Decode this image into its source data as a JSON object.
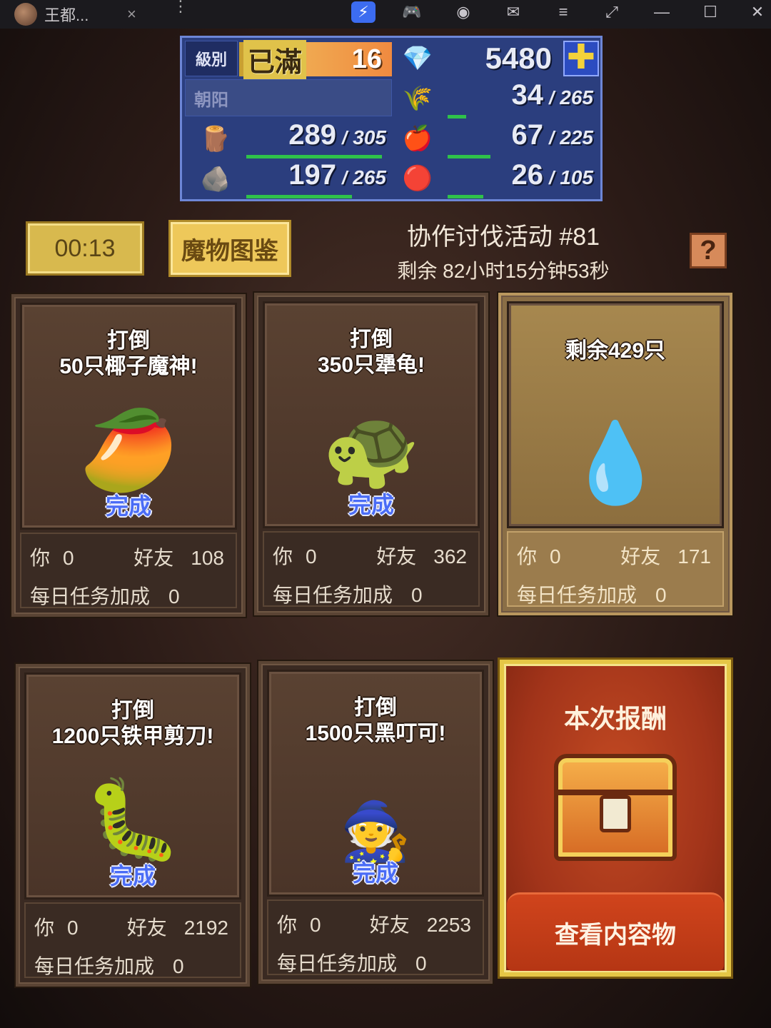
{
  "titlebar": {
    "tab_title": "王都...",
    "tab_close": "×",
    "more": "⋮",
    "icons": [
      "app-active-icon",
      "gamepad-icon",
      "account-icon",
      "mail-icon",
      "menu-icon",
      "screenshot-icon",
      "minimize-icon",
      "maximize-icon",
      "close-icon"
    ],
    "icon_glyphs": [
      "⚡",
      "🎮",
      "◉",
      "✉",
      "≡",
      "⤢",
      "—",
      "☐",
      "✕"
    ]
  },
  "status": {
    "level_label": "級別",
    "level_state": "已滿",
    "level_num": "16",
    "town_name": "朝阳",
    "gems": "5480",
    "plus": "✚",
    "resources_left": [
      {
        "icon": "🪵",
        "name": "wood-icon",
        "current": "289",
        "max": "305",
        "fill": 0.95
      },
      {
        "icon": "🪨",
        "name": "ore-icon",
        "current": "197",
        "max": "265",
        "fill": 0.74
      }
    ],
    "resources_right": [
      {
        "icon": "🌾",
        "name": "grass-icon",
        "current": "34",
        "max": "265",
        "fill": 0.13
      },
      {
        "icon": "🍎",
        "name": "food-icon",
        "current": "67",
        "max": "225",
        "fill": 0.3
      },
      {
        "icon": "🔴",
        "name": "crystal-icon",
        "current": "26",
        "max": "105",
        "fill": 0.25
      }
    ],
    "gem_icon": "💎"
  },
  "event": {
    "timer": "00:13",
    "bestiary_button": "魔物图鉴",
    "title": "协作讨伐活动 #81",
    "remaining": "剩余 82小时15分钟53秒",
    "help": "?"
  },
  "quests": [
    {
      "line1": "打倒",
      "line2": "50只椰子魔神!",
      "monster": "🥭",
      "done": "完成",
      "you_label": "你",
      "you": "0",
      "friend_label": "好友",
      "friend": "108",
      "daily_label": "每日任务加成",
      "daily": "0"
    },
    {
      "line1": "打倒",
      "line2": "350只犟龟!",
      "monster": "🐢",
      "done": "完成",
      "you_label": "你",
      "you": "0",
      "friend_label": "好友",
      "friend": "362",
      "daily_label": "每日任务加成",
      "daily": "0"
    },
    {
      "line1": "剩余429只",
      "line2": "",
      "monster": "💧",
      "done": "",
      "you_label": "你",
      "you": "0",
      "friend_label": "好友",
      "friend": "171",
      "daily_label": "每日任务加成",
      "daily": "0"
    },
    {
      "line1": "打倒",
      "line2": "1200只铁甲剪刀!",
      "monster": "🐛",
      "done": "完成",
      "you_label": "你",
      "you": "0",
      "friend_label": "好友",
      "friend": "2192",
      "daily_label": "每日任务加成",
      "daily": "0"
    },
    {
      "line1": "打倒",
      "line2": "1500只黑叮可!",
      "monster": "🧙",
      "done": "完成",
      "you_label": "你",
      "you": "0",
      "friend_label": "好友",
      "friend": "2253",
      "daily_label": "每日任务加成",
      "daily": "0"
    }
  ],
  "reward": {
    "title": "本次报酬",
    "view_button": "查看内容物"
  }
}
